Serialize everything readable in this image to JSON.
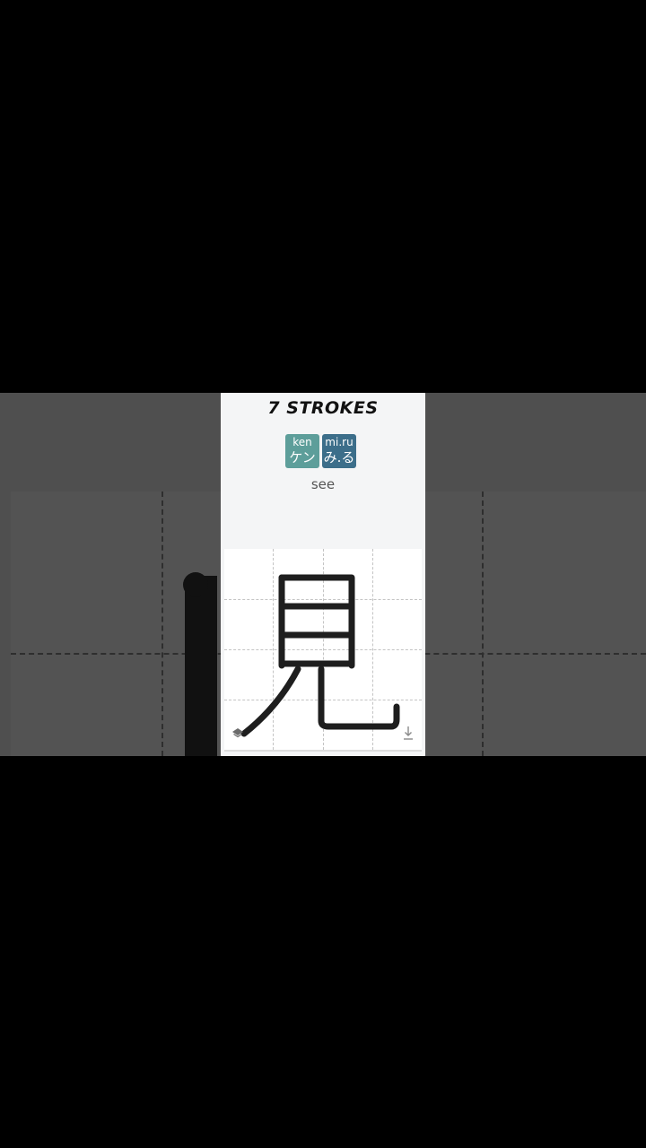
{
  "card": {
    "title": "7 STROKES",
    "readings": [
      {
        "latin": "ken",
        "kana": "ケン",
        "type": "onyomi",
        "color": "#5d9e9a"
      },
      {
        "latin": "mi.ru",
        "kana": "み.る",
        "type": "kunyomi",
        "color": "#3c6e8a"
      }
    ],
    "meaning": "see"
  },
  "icons": {
    "layers": "layers-icon",
    "download": "download-icon"
  },
  "colors": {
    "letterbox": "#000000",
    "background_band": "#4f4f4f",
    "card_background": "#f4f5f6",
    "stroke": "#1e1e1e"
  }
}
